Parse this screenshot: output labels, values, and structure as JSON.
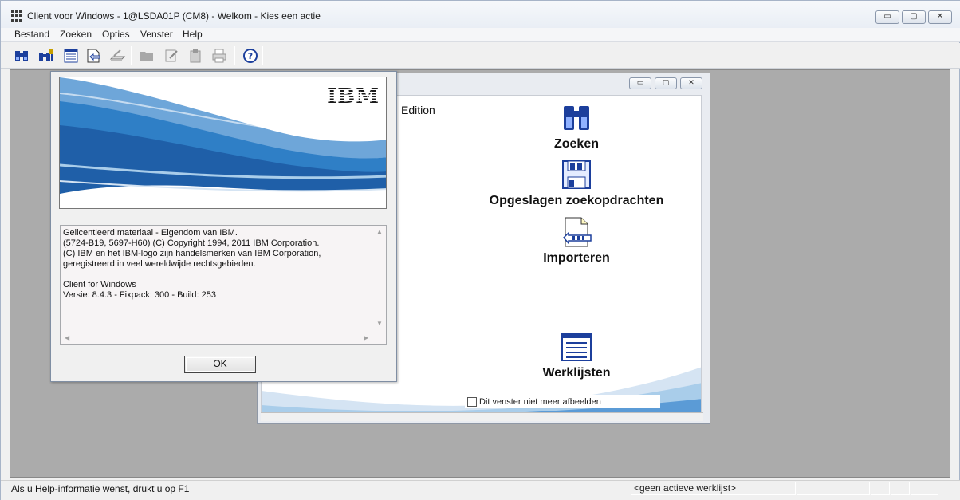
{
  "window": {
    "title": "Client voor Windows - 1@LSDA01P (CM8) - Welkom - Kies een actie",
    "controls": {
      "minimize": "▭",
      "maximize": "▢",
      "close": "✕"
    }
  },
  "menubar": {
    "items": [
      {
        "label": "Bestand"
      },
      {
        "label": "Zoeken"
      },
      {
        "label": "Opties"
      },
      {
        "label": "Venster"
      },
      {
        "label": "Help"
      }
    ]
  },
  "toolbar": {
    "buttons": [
      {
        "icon": "binoculars-icon"
      },
      {
        "icon": "multi-search-icon"
      },
      {
        "icon": "worklist-icon"
      },
      {
        "icon": "import-icon"
      },
      {
        "icon": "scan-icon"
      },
      {
        "icon": "folder-icon"
      },
      {
        "icon": "edit-icon"
      },
      {
        "icon": "clipboard-icon"
      },
      {
        "icon": "print-icon"
      },
      {
        "icon": "help-icon"
      }
    ]
  },
  "welcome_window": {
    "controls": {
      "minimize": "▭",
      "maximize": "▢",
      "close": "✕"
    },
    "edition_text": "Edition",
    "actions": {
      "search": {
        "label": "Zoeken",
        "icon": "binoculars-icon"
      },
      "saved": {
        "label": "Opgeslagen zoekopdrachten",
        "icon": "saved-searches-icon"
      },
      "import": {
        "label": "Importeren",
        "icon": "import-document-icon"
      },
      "worklists": {
        "label": "Werklijsten",
        "icon": "worklist-icon"
      }
    },
    "checkbox_label": "Dit venster niet meer afbeelden",
    "checkbox_checked": false
  },
  "about_dialog": {
    "logo": "IBM",
    "lines": [
      "Gelicentieerd materiaal - Eigendom van IBM.",
      "(5724-B19, 5697-H60) (C) Copyright 1994, 2011 IBM Corporation.",
      " (C) IBM en het IBM-logo zijn handelsmerken van IBM Corporation,",
      "geregistreerd in veel wereldwijde rechtsgebieden.",
      "",
      "Client for Windows",
      "Versie: 8.4.3 - Fixpack: 300 - Build: 253"
    ],
    "ok_label": "OK"
  },
  "statusbar": {
    "help_text": "Als u Help-informatie wenst, drukt u op F1",
    "worklist": "<geen actieve werklijst>"
  },
  "colors": {
    "banner_blue": "#2f7fc6",
    "banner_light": "#a9cdea"
  }
}
